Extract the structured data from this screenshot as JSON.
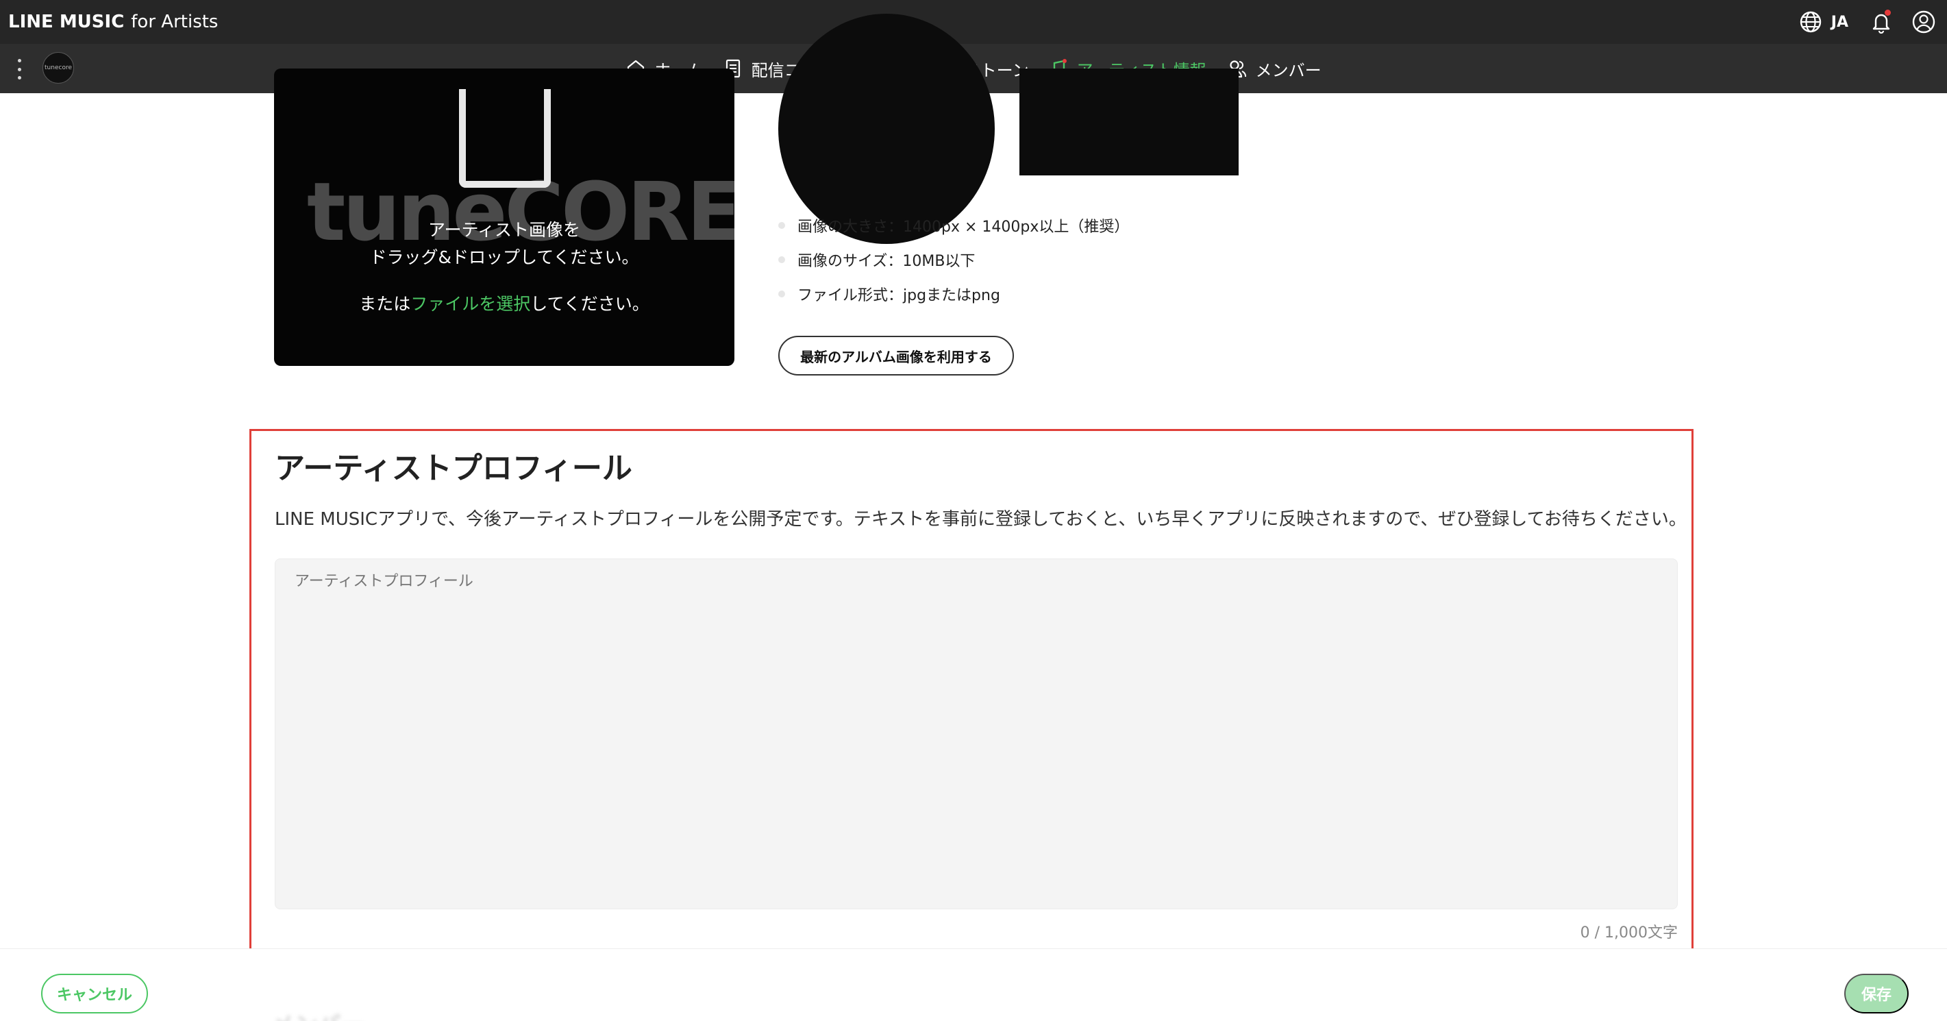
{
  "app": {
    "brand_main": "LINE MUSIC",
    "brand_sub": "for Artists",
    "language": "JA",
    "accent_color": "#4cc764",
    "danger_color": "#e0403a"
  },
  "header_icons": {
    "language": "globe-icon",
    "notifications": "bell-icon",
    "account": "user-icon"
  },
  "artist": {
    "avatar_label": "tunecore"
  },
  "nav": {
    "items": [
      {
        "label": "ホーム",
        "icon": "home-icon",
        "active": false
      },
      {
        "label": "配信コンテンツ",
        "icon": "document-icon",
        "active": false
      },
      {
        "label": "マイルストーン",
        "icon": "flag-icon",
        "active": false
      },
      {
        "label": "アーティスト情報",
        "icon": "music-note-icon",
        "active": true
      },
      {
        "label": "メンバー",
        "icon": "members-icon",
        "active": false
      }
    ]
  },
  "upload": {
    "line1": "アーティスト画像を",
    "line2": "ドラッグ&ドロップしてください。",
    "or_prefix": "または",
    "select_link": "ファイルを選択",
    "or_suffix": "してください。",
    "watermark": "tuneCORE"
  },
  "guidelines": [
    "画像の大きさ：1400px × 1400px以上（推奨）",
    "画像のサイズ：10MB以下",
    "ファイル形式：jpgまたはpng"
  ],
  "album_button": "最新のアルバム画像を利用する",
  "profile": {
    "title": "アーティストプロフィール",
    "description": "LINE MUSICアプリで、今後アーティストプロフィールを公開予定です。テキストを事前に登録しておくと、いち早くアプリに反映されますので、ぜひ登録してお待ちください。",
    "placeholder": "アーティストプロフィール",
    "value": "",
    "char_count": "0 / 1,000文字"
  },
  "footer": {
    "cancel": "キャンセル",
    "save": "保存",
    "next_section_ghost": "メンバー"
  }
}
